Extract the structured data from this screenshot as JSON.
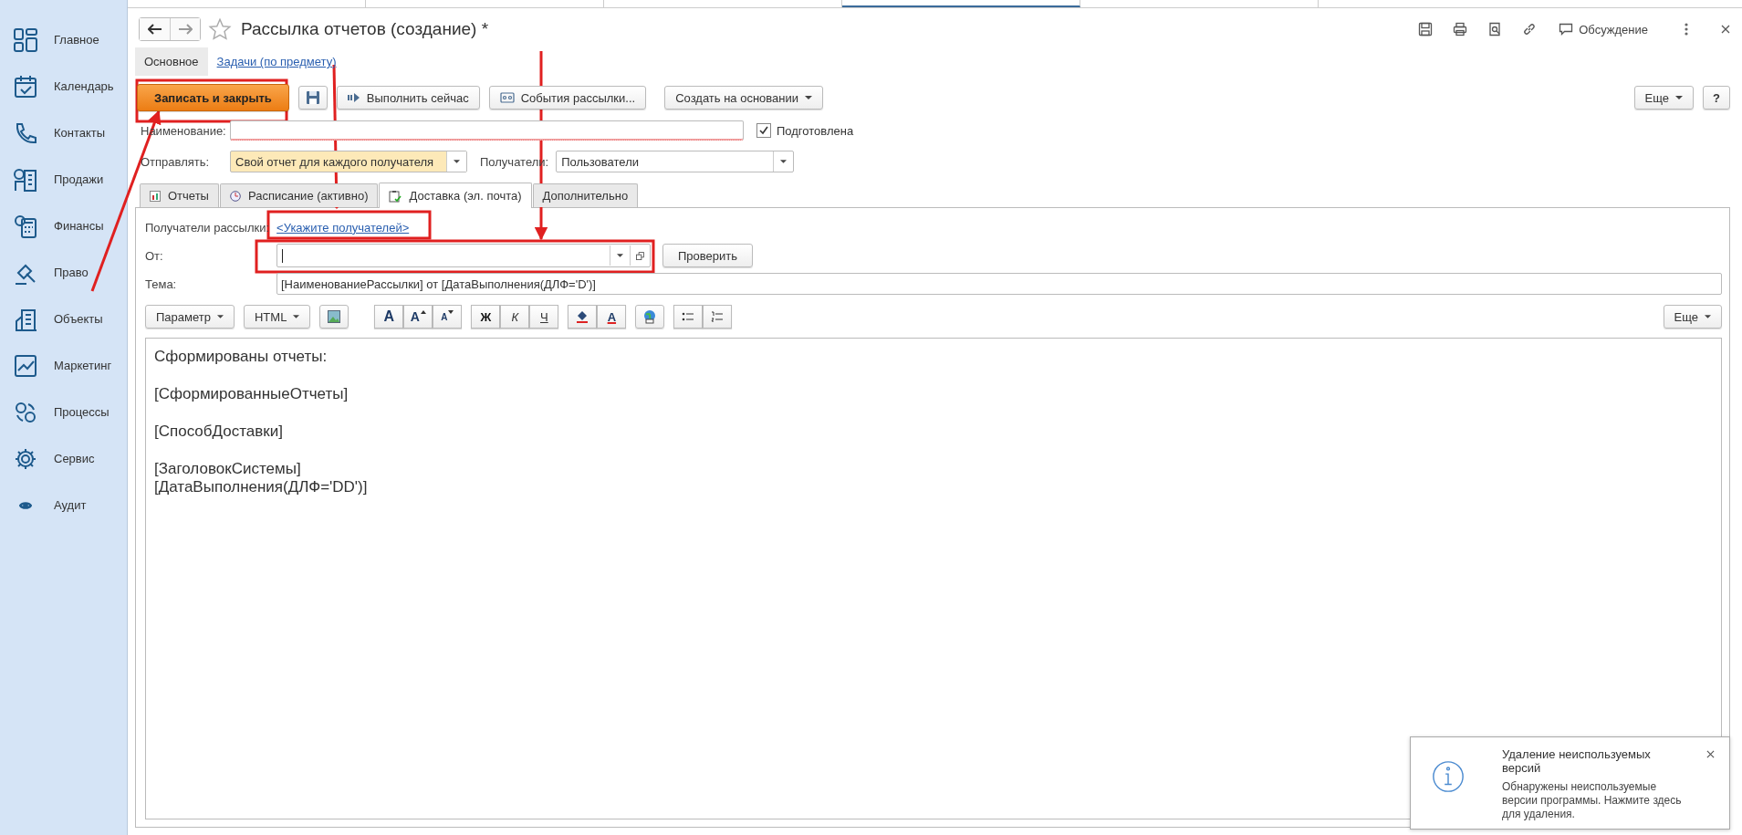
{
  "sidebar": {
    "items": [
      {
        "label": "Главное"
      },
      {
        "label": "Календарь"
      },
      {
        "label": "Контакты"
      },
      {
        "label": "Продажи"
      },
      {
        "label": "Финансы"
      },
      {
        "label": "Право"
      },
      {
        "label": "Объекты"
      },
      {
        "label": "Маркетинг"
      },
      {
        "label": "Процессы"
      },
      {
        "label": "Сервис"
      },
      {
        "label": "Аудит"
      }
    ]
  },
  "header": {
    "title": "Рассылка отчетов (создание) *",
    "discuss_label": "Обсуждение"
  },
  "form_tabs": [
    {
      "label": "Основное",
      "selected": true
    },
    {
      "label": "Задачи (по предмету)",
      "selected": false
    }
  ],
  "toolbar": {
    "save_close": "Записать и закрыть",
    "run_now": "Выполнить сейчас",
    "events": "События рассылки...",
    "create_based": "Создать на основании",
    "more": "Еще",
    "help": "?"
  },
  "name_field": {
    "label": "Наименование:",
    "required": true
  },
  "prepared": {
    "label": "Подготовлена",
    "checked": true
  },
  "send": {
    "label": "Отправлять:",
    "value": "Свой отчет для каждого получателя"
  },
  "recipients": {
    "label": "Получатели:",
    "value": "Пользователи"
  },
  "tabs": [
    {
      "label": "Отчеты",
      "selected": false
    },
    {
      "label": "Расписание (активно)",
      "selected": false
    },
    {
      "label": "Доставка (эл. почта)",
      "selected": true
    },
    {
      "label": "Дополнительно",
      "selected": false
    }
  ],
  "delivery": {
    "recipients_label": "Получатели рассылки:",
    "recipients_link": "<Укажите получателей>",
    "from_label": "От:",
    "check_button": "Проверить",
    "subject_label": "Тема:",
    "subject_value": "[НаименованиеРассылки] от [ДатаВыполнения(ДЛФ='D')]"
  },
  "editor_toolbar": {
    "param": "Параметр",
    "html": "HTML",
    "font_buttons": [
      "A",
      "A",
      "A"
    ],
    "style_buttons": [
      "Ж",
      "К",
      "Ч"
    ],
    "font_color": "A",
    "more": "Еще"
  },
  "editor": {
    "paragraphs": [
      [
        "Сформированы отчеты:"
      ],
      [
        "[СформированныеОтчеты]"
      ],
      [
        "[СпособДоставки]"
      ],
      [
        "[ЗаголовокСистемы]",
        "[ДатаВыполнения(ДЛФ='DD')]"
      ]
    ]
  },
  "notification": {
    "title": "Удаление неиспользуемых версий",
    "body": "Обнаружены неиспользуемые версии программы. Нажмите здесь для удаления."
  }
}
